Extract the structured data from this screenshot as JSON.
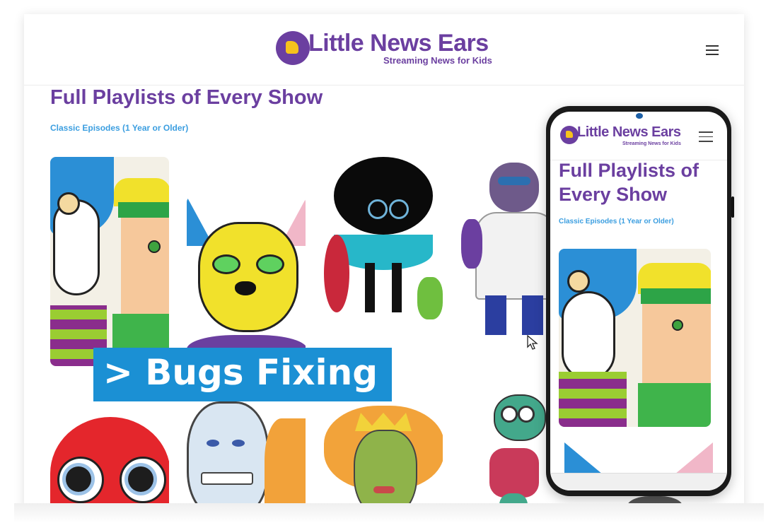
{
  "site": {
    "logo_title": "Little News Ears",
    "logo_tagline": "Streaming News for Kids"
  },
  "main": {
    "page_title": "Full Playlists of Every Show",
    "section_link": "Classic Episodes (1 Year or Older)"
  },
  "cards": [
    {
      "name": "dog-boy-episode"
    },
    {
      "name": "yellow-cat-episode"
    },
    {
      "name": "afro-character-episode"
    },
    {
      "name": "gorilla-doctor-episode"
    },
    {
      "name": "red-fox-episode"
    },
    {
      "name": "rhino-tiger-episode"
    },
    {
      "name": "green-queen-episode"
    },
    {
      "name": "green-dinosaur-episode"
    }
  ],
  "overlay": {
    "banner_text": "> Bugs Fixing"
  },
  "mobile": {
    "logo_title": "Little News Ears",
    "logo_tagline": "Streaming News for Kids",
    "page_title": "Full Playlists of Every Show",
    "section_link": "Classic Episodes (1 Year or Older)"
  },
  "colors": {
    "brand_purple": "#6b3fa0",
    "link_blue": "#3b9ee0",
    "banner_blue": "#1b90d4"
  }
}
